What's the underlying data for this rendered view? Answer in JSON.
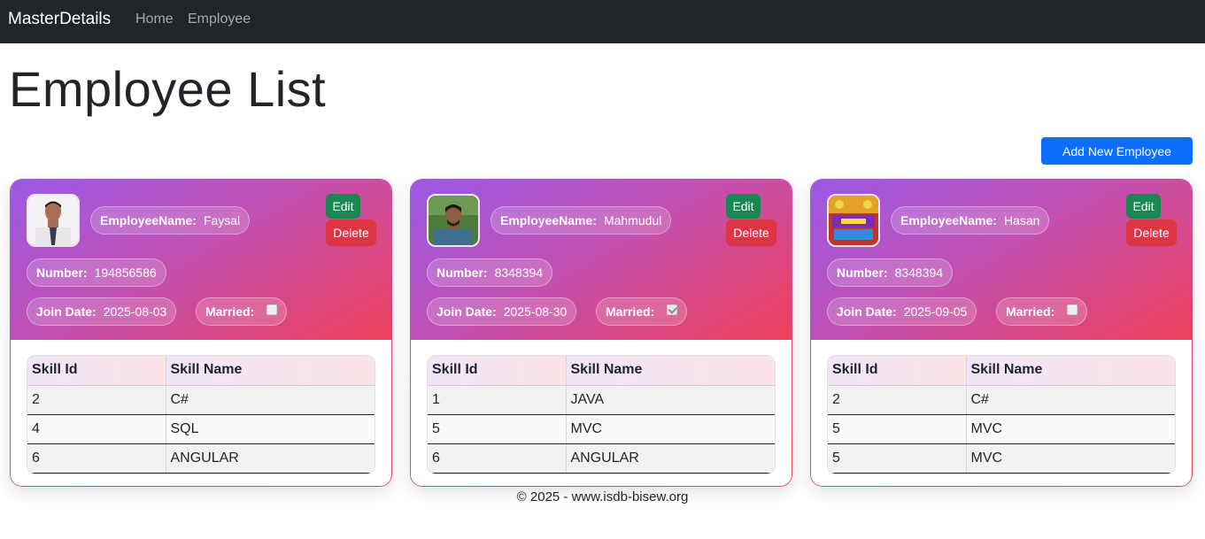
{
  "navbar": {
    "brand": "MasterDetails",
    "links": [
      {
        "label": "Home"
      },
      {
        "label": "Employee"
      }
    ]
  },
  "page": {
    "title": "Employee List",
    "add_button": "Add New Employee"
  },
  "labels": {
    "employee_name": "EmployeeName:",
    "number": "Number:",
    "join_date": "Join Date:",
    "married": "Married:",
    "edit": "Edit",
    "delete": "Delete",
    "skill_id_header": "Skill Id",
    "skill_name_header": "Skill Name"
  },
  "employees": [
    {
      "name": "Faysal",
      "number": "194856586",
      "join_date": "2025-08-03",
      "married": false,
      "skills": [
        {
          "id": "2",
          "name": "C#"
        },
        {
          "id": "4",
          "name": "SQL"
        },
        {
          "id": "6",
          "name": "ANGULAR"
        }
      ]
    },
    {
      "name": "Mahmudul",
      "number": "8348394",
      "join_date": "2025-08-30",
      "married": true,
      "skills": [
        {
          "id": "1",
          "name": "JAVA"
        },
        {
          "id": "5",
          "name": "MVC"
        },
        {
          "id": "6",
          "name": "ANGULAR"
        }
      ]
    },
    {
      "name": "Hasan",
      "number": "8348394",
      "join_date": "2025-09-05",
      "married": false,
      "skills": [
        {
          "id": "2",
          "name": "C#"
        },
        {
          "id": "5",
          "name": "MVC"
        },
        {
          "id": "5",
          "name": "MVC"
        }
      ]
    }
  ],
  "footer": {
    "text": "© 2025 - www.isdb-bisew.org"
  },
  "colors": {
    "navbar": "#212529",
    "primary": "#0d6efd",
    "success": "#198754",
    "danger": "#dc3545",
    "gradient_start": "#9b59e6",
    "gradient_end": "#ee405a"
  }
}
